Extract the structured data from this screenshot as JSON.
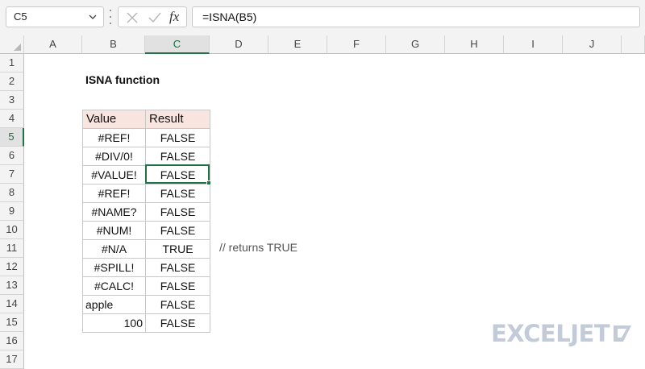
{
  "formula_bar": {
    "name_box": "C5",
    "fx_label": "fx",
    "formula": "=ISNA(B5)"
  },
  "columns": [
    "A",
    "B",
    "C",
    "D",
    "E",
    "F",
    "G",
    "H",
    "I",
    "J"
  ],
  "active_column": "C",
  "rows": [
    "1",
    "2",
    "3",
    "4",
    "5",
    "6",
    "7",
    "8",
    "9",
    "10",
    "11",
    "12",
    "13",
    "14",
    "15",
    "16",
    "17"
  ],
  "active_row": "5",
  "sheet": {
    "title": "ISNA function",
    "table_headers": [
      "Value",
      "Result"
    ],
    "table_rows": [
      {
        "value": "#REF!",
        "result": "FALSE"
      },
      {
        "value": "#DIV/0!",
        "result": "FALSE"
      },
      {
        "value": "#VALUE!",
        "result": "FALSE"
      },
      {
        "value": "#REF!",
        "result": "FALSE"
      },
      {
        "value": "#NAME?",
        "result": "FALSE"
      },
      {
        "value": "#NUM!",
        "result": "FALSE"
      },
      {
        "value": "#N/A",
        "result": "TRUE"
      },
      {
        "value": "#SPILL!",
        "result": "FALSE"
      },
      {
        "value": "#CALC!",
        "result": "FALSE"
      },
      {
        "value": "apple",
        "result": "FALSE"
      },
      {
        "value": "100",
        "result": "FALSE"
      }
    ],
    "note": "// returns TRUE"
  },
  "logo": {
    "text": "EXCELJET"
  },
  "colors": {
    "header_fill": "#f8e5df",
    "selection": "#217346",
    "logo": "#c3cbd8"
  }
}
